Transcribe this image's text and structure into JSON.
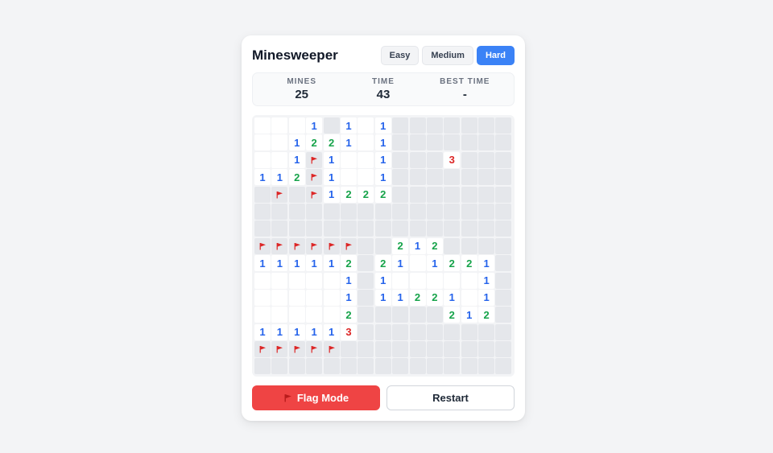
{
  "game": {
    "title": "Minesweeper",
    "difficulties": [
      {
        "label": "Easy",
        "active": false
      },
      {
        "label": "Medium",
        "active": false
      },
      {
        "label": "Hard",
        "active": true
      }
    ],
    "stats": {
      "mines_label": "MINES",
      "mines_value": "25",
      "time_label": "TIME",
      "time_value": "43",
      "best_label": "BEST TIME",
      "best_value": "-"
    },
    "board": {
      "legend": "H = hidden, F = flagged, 0 = opened empty, 1-8 = opened number",
      "rows": [
        [
          "0",
          "0",
          "0",
          "1",
          "H",
          "1",
          "0",
          "1",
          "H",
          "H",
          "H",
          "H",
          "H",
          "H",
          "H"
        ],
        [
          "0",
          "0",
          "1",
          "2",
          "2",
          "1",
          "0",
          "1",
          "H",
          "H",
          "H",
          "H",
          "H",
          "H",
          "H"
        ],
        [
          "0",
          "0",
          "1",
          "F",
          "1",
          "0",
          "0",
          "1",
          "H",
          "H",
          "H",
          "3",
          "H",
          "H",
          "H"
        ],
        [
          "1",
          "1",
          "2",
          "F",
          "1",
          "0",
          "0",
          "1",
          "H",
          "H",
          "H",
          "H",
          "H",
          "H",
          "H"
        ],
        [
          "H",
          "F",
          "H",
          "F",
          "1",
          "2",
          "2",
          "2",
          "H",
          "H",
          "H",
          "H",
          "H",
          "H",
          "H"
        ],
        [
          "H",
          "H",
          "H",
          "H",
          "H",
          "H",
          "H",
          "H",
          "H",
          "H",
          "H",
          "H",
          "H",
          "H",
          "H"
        ],
        [
          "H",
          "H",
          "H",
          "H",
          "H",
          "H",
          "H",
          "H",
          "H",
          "H",
          "H",
          "H",
          "H",
          "H",
          "H"
        ],
        [
          "F",
          "F",
          "F",
          "F",
          "F",
          "F",
          "H",
          "H",
          "2",
          "1",
          "2",
          "H",
          "H",
          "H",
          "H"
        ],
        [
          "1",
          "1",
          "1",
          "1",
          "1",
          "2",
          "H",
          "2",
          "1",
          "0",
          "1",
          "2",
          "2",
          "1",
          "H"
        ],
        [
          "0",
          "0",
          "0",
          "0",
          "0",
          "1",
          "H",
          "1",
          "0",
          "0",
          "0",
          "0",
          "0",
          "1",
          "H"
        ],
        [
          "0",
          "0",
          "0",
          "0",
          "0",
          "1",
          "H",
          "1",
          "1",
          "2",
          "2",
          "1",
          "0",
          "1",
          "H"
        ],
        [
          "0",
          "0",
          "0",
          "0",
          "0",
          "2",
          "H",
          "H",
          "H",
          "H",
          "H",
          "2",
          "1",
          "2",
          "H"
        ],
        [
          "1",
          "1",
          "1",
          "1",
          "1",
          "3",
          "H",
          "H",
          "H",
          "H",
          "H",
          "H",
          "H",
          "H",
          "H"
        ],
        [
          "F",
          "F",
          "F",
          "F",
          "F",
          "H",
          "H",
          "H",
          "H",
          "H",
          "H",
          "H",
          "H",
          "H",
          "H"
        ],
        [
          "H",
          "H",
          "H",
          "H",
          "H",
          "H",
          "H",
          "H",
          "H",
          "H",
          "H",
          "H",
          "H",
          "H",
          "H"
        ]
      ]
    },
    "actions": {
      "flag_mode_label": "Flag Mode",
      "flag_mode_icon": "flag-icon",
      "restart_label": "Restart"
    },
    "colors": {
      "accent": "#3b82f6",
      "flag_button": "#ef4444",
      "number_1": "#2563eb",
      "number_2": "#16a34a",
      "number_3": "#dc2626",
      "flag": "#dc2626"
    }
  }
}
